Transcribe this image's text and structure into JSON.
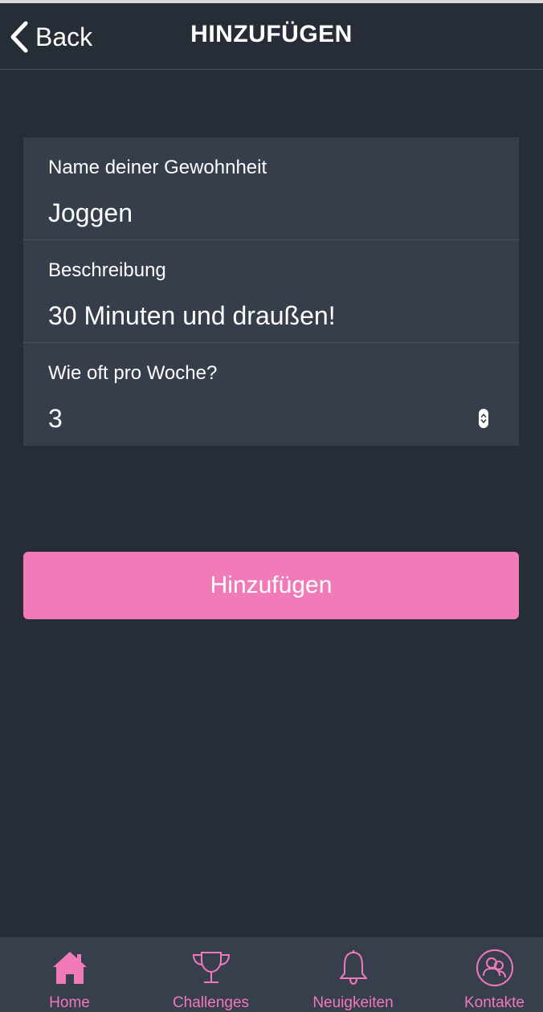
{
  "header": {
    "back_label": "Back",
    "title": "HINZUFÜGEN"
  },
  "form": {
    "fields": [
      {
        "label": "Name deiner Gewohnheit",
        "value": "Joggen"
      },
      {
        "label": "Beschreibung",
        "value": "30 Minuten und draußen!"
      },
      {
        "label": "Wie oft pro Woche?",
        "value": "3"
      }
    ]
  },
  "submit_label": "Hinzufügen",
  "tabs": [
    {
      "label": "Home",
      "icon": "home-icon",
      "active": true
    },
    {
      "label": "Challenges",
      "icon": "trophy-icon",
      "active": false
    },
    {
      "label": "Neuigkeiten",
      "icon": "bell-icon",
      "active": false
    },
    {
      "label": "Kontakte",
      "icon": "contacts-icon",
      "active": false
    }
  ],
  "colors": {
    "background": "#272d37",
    "card": "#363d4b",
    "accent": "#f17ab9",
    "tab_bar": "#373e4c"
  }
}
